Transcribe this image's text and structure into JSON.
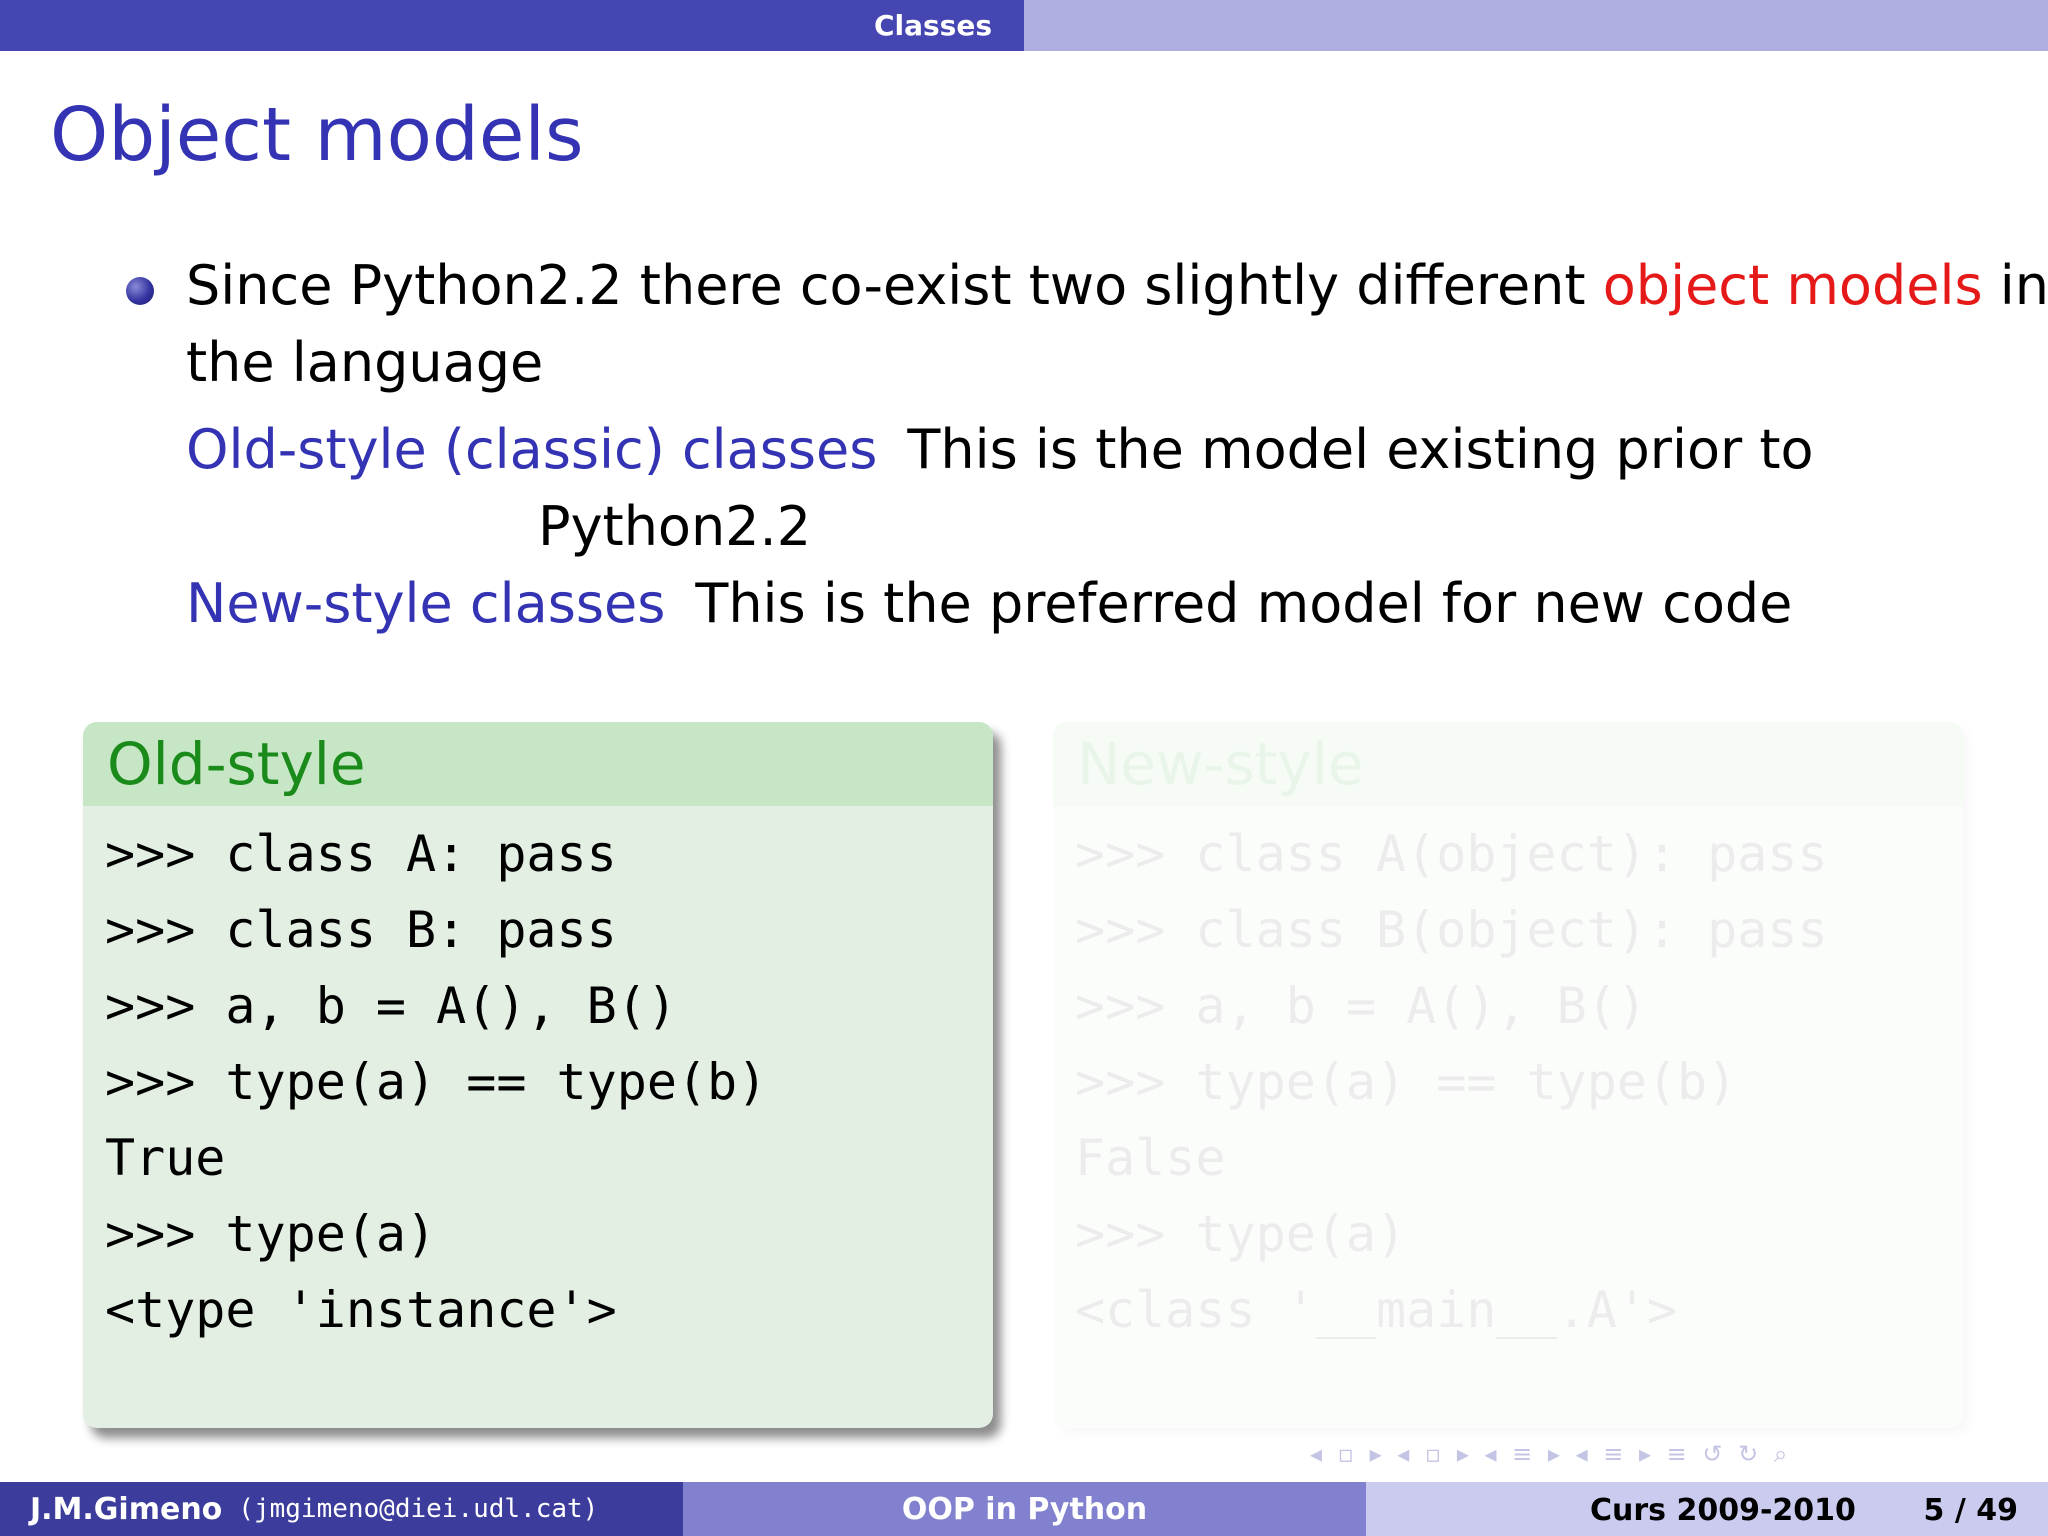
{
  "header": {
    "section": "Classes"
  },
  "slide": {
    "title": "Object models",
    "bullet": {
      "line1_prefix": "Since Python2.2 there co-exist two slightly different ",
      "line1_highlight": "object models",
      "line1_suffix": " in",
      "line2": "the language"
    },
    "defs": [
      {
        "term": "Old-style (classic) classes",
        "desc_line1": "This is the model existing prior to",
        "desc_line2": "Python2.2"
      },
      {
        "term": "New-style classes",
        "desc_line1": "This is the preferred model for new code"
      }
    ],
    "blocks": {
      "old": {
        "title": "Old-style",
        "code": ">>> class A: pass\n>>> class B: pass\n>>> a, b = A(), B()\n>>> type(a) == type(b)\nTrue\n>>> type(a)\n<type 'instance'>"
      },
      "new": {
        "title": "New-style",
        "code": ">>> class A(object): pass\n>>> class B(object): pass\n>>> a, b = A(), B()\n>>> type(a) == type(b)\nFalse\n>>> type(a)\n<class '__main__.A'>"
      }
    },
    "nav_symbols": "◂ ▫ ▸ ◂ ▫ ▸ ◂ ≡ ▸ ◂ ≡ ▸   ≡   ↺ ↻ ⌕"
  },
  "footer": {
    "author": "J.M.Gimeno",
    "email": "(jmgimeno@diei.udl.cat)",
    "title": "OOP in Python",
    "course": "Curs 2009-2010",
    "page": "5 / 49"
  },
  "colors": {
    "header_left": "#4646b3",
    "header_right": "#aeaee0",
    "title": "#3333b3",
    "highlight": "#e61919",
    "block_header": "#c6e6c6",
    "block_title": "#1a8a1a",
    "block_body": "#e3efe3"
  }
}
